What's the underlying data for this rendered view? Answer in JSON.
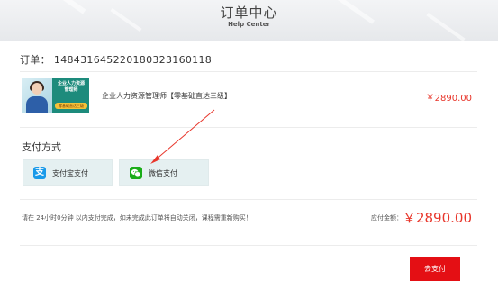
{
  "header": {
    "title": "订单中心",
    "subtitle": "Help Center"
  },
  "order": {
    "label": "订单：",
    "number": "14843164522018032316011​8"
  },
  "product": {
    "thumbnail_text": [
      "企业人力资源",
      "管理师"
    ],
    "thumbnail_tag": "零基础直达三级",
    "name": "企业人力资源管理师【零基础直达三级】",
    "price": "￥2890.00"
  },
  "payment": {
    "title": "支付方式",
    "options": [
      {
        "label": "支付宝支付",
        "icon": "alipay-icon",
        "glyph": "支",
        "color": "#1a9ae9"
      },
      {
        "label": "微信支付",
        "icon": "wechat-icon",
        "glyph": "●",
        "color": "#1aad19"
      }
    ]
  },
  "footer": {
    "notice": "请在 24小时0分钟 以内支付完成，如未完成此订单将自动关闭，课程需重新购买！",
    "amount_label": "应付金额：",
    "amount": "￥2890.00",
    "pay_button": "去支付"
  },
  "colors": {
    "accent_red": "#e40f14",
    "price_red": "#e8362b",
    "option_bg": "#e5f0f1"
  }
}
